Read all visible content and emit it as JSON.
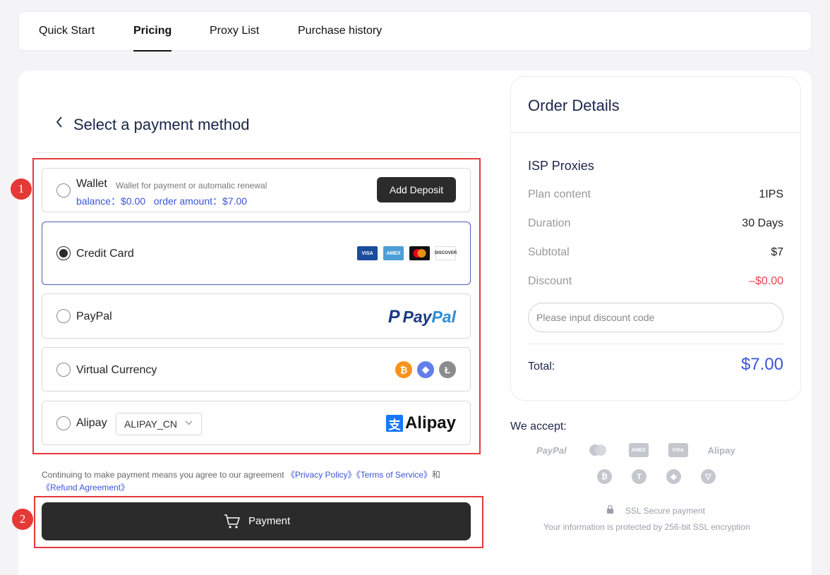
{
  "tabs": [
    {
      "label": "Quick Start"
    },
    {
      "label": "Pricing",
      "active": true
    },
    {
      "label": "Proxy List"
    },
    {
      "label": "Purchase history"
    }
  ],
  "payment": {
    "title": "Select a payment method",
    "wallet": {
      "label": "Wallet",
      "subtitle": "Wallet for payment or automatic renewal",
      "balance_text": "balance：$0.00   order amount：$7.00",
      "add_deposit": "Add Deposit"
    },
    "credit_card": {
      "label": "Credit Card",
      "selected": true,
      "cards": [
        "VISA",
        "AMEX",
        "",
        "DISCOVER"
      ]
    },
    "paypal": {
      "label": "PayPal",
      "logo_p": "P",
      "logo1": "Pay",
      "logo2": "Pal"
    },
    "virtual": {
      "label": "Virtual Currency",
      "coins": [
        "₿",
        "◆",
        "Ł"
      ]
    },
    "alipay": {
      "label": "Alipay",
      "select_value": "ALIPAY_CN",
      "logo_char": "支",
      "logo_text": "Alipay"
    },
    "badges": [
      "1",
      "2"
    ],
    "agreement": {
      "prefix": "Continuing to make payment means you agree to our agreement ",
      "privacy": "《Privacy Policy》",
      "terms": "《Terms of Service》",
      "and": "和",
      "refund": "《Refund Agreement》"
    },
    "pay_button": "Payment"
  },
  "order": {
    "title": "Order Details",
    "product": "ISP Proxies",
    "rows": [
      {
        "key": "Plan content",
        "value": "1IPS"
      },
      {
        "key": "Duration",
        "value": "30 Days"
      },
      {
        "key": "Subtotal",
        "value": "$7"
      },
      {
        "key": "Discount",
        "value": "–$0.00"
      }
    ],
    "discount_placeholder": "Please input discount code",
    "total_label": "Total:",
    "total_value": "$7.00"
  },
  "accept": {
    "title": "We accept:",
    "methods": [
      "PayPal",
      "",
      "AMEX",
      "VISA",
      "Alipay"
    ],
    "coins": [
      "₿",
      "T",
      "◆",
      "▽"
    ],
    "ssl": "SSL Secure payment",
    "ssl_sub": "Your information is protected by 256-bit SSL encryption"
  },
  "colors": {
    "accent": "#3b55d6",
    "dark": "#2b2b2b",
    "red": "#e43a3a",
    "discount": "#e5484d"
  }
}
